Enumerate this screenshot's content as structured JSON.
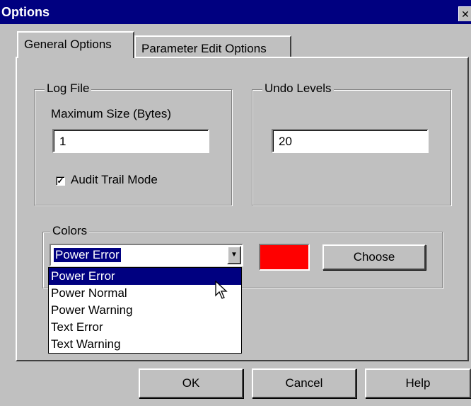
{
  "window": {
    "title": "Options",
    "close_glyph": "✕"
  },
  "tabs": [
    {
      "label": "General Options",
      "active": true
    },
    {
      "label": "Parameter Edit Options",
      "active": false
    }
  ],
  "log_file": {
    "legend": "Log File",
    "max_size_label": "Maximum Size (Bytes)",
    "max_size_value": "1",
    "audit_trail_label": "Audit Trail Mode",
    "audit_trail_checked": true,
    "check_glyph": "✓"
  },
  "undo": {
    "legend": "Undo Levels",
    "value": "20"
  },
  "colors": {
    "legend": "Colors",
    "selected": "Power Error",
    "arrow_glyph": "▼",
    "options": [
      "Power Error",
      "Power Normal",
      "Power Warning",
      "Text Error",
      "Text Warning"
    ],
    "swatch_color": "#ff0000",
    "choose_label": "Choose"
  },
  "buttons": {
    "ok": "OK",
    "cancel": "Cancel",
    "help": "Help"
  },
  "accent_colors": {
    "titlebar": "#000080",
    "face": "#c0c0c0",
    "highlight": "#000080"
  }
}
